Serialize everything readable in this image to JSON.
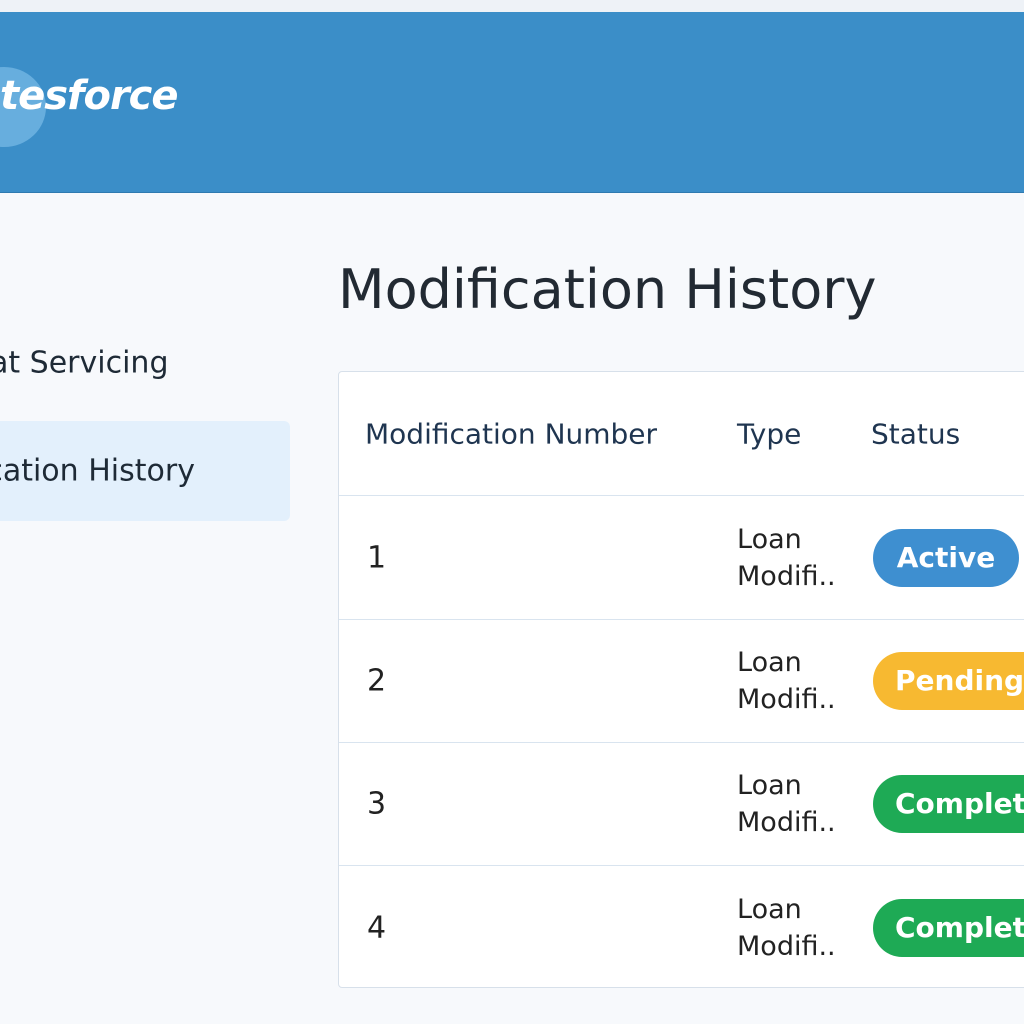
{
  "header": {
    "logo_text": "tesforce",
    "brand_color": "#3b8ec8"
  },
  "sidebar": {
    "items": [
      {
        "label": "at Servicing",
        "selected": false
      },
      {
        "label": "ication History",
        "selected": true
      }
    ]
  },
  "main": {
    "title": "Modification History",
    "table": {
      "columns": [
        "Modification Number",
        "Type",
        "Status"
      ],
      "rows": [
        {
          "number": "1",
          "type_line1": "Loan",
          "type_line2": "Modifi..",
          "status": "Active",
          "status_color": "#3e8fd0"
        },
        {
          "number": "2",
          "type_line1": "Loan",
          "type_line2": "Modifi..",
          "status": "Pending",
          "status_color": "#f7b931"
        },
        {
          "number": "3",
          "type_line1": "Loan",
          "type_line2": "Modifi..",
          "status": "Completed",
          "status_color": "#1eaa55"
        },
        {
          "number": "4",
          "type_line1": "Loan",
          "type_line2": "Modifi..",
          "status": "Completed",
          "status_color": "#1eaa55"
        }
      ]
    }
  }
}
